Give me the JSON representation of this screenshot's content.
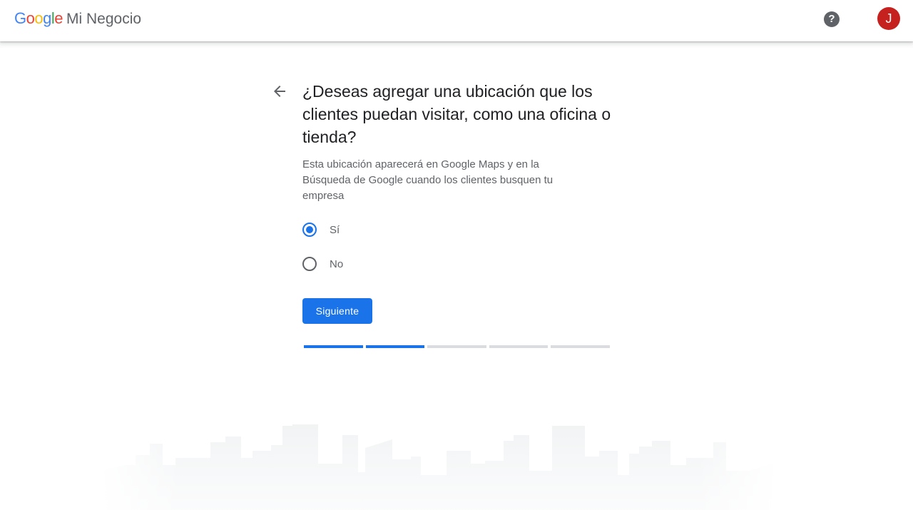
{
  "header": {
    "logo_letters": [
      {
        "ch": "G",
        "color": "#4285F4"
      },
      {
        "ch": "o",
        "color": "#EA4335"
      },
      {
        "ch": "o",
        "color": "#FBBC05"
      },
      {
        "ch": "g",
        "color": "#4285F4"
      },
      {
        "ch": "l",
        "color": "#34A853"
      },
      {
        "ch": "e",
        "color": "#EA4335"
      }
    ],
    "product_name": "Mi Negocio",
    "help_symbol": "?",
    "avatar_initial": "J"
  },
  "question": {
    "title": "¿Deseas agregar una ubicación que los clientes puedan visitar, como una oficina o tienda?",
    "subtitle": "Esta ubicación aparecerá en Google Maps y en la Búsqueda de Google cuando los clientes busquen tu empresa"
  },
  "options": [
    {
      "label": "Sí",
      "selected": true
    },
    {
      "label": "No",
      "selected": false
    }
  ],
  "next_button_label": "Siguiente",
  "progress": {
    "completed_steps": 2,
    "total_steps": 5
  },
  "colors": {
    "accent": "#1a73e8",
    "avatar": "#c5221f",
    "text_primary": "#202124",
    "text_secondary": "#5f6368"
  },
  "icons": {
    "back": "arrow-left-icon",
    "help": "help-circle-icon"
  }
}
